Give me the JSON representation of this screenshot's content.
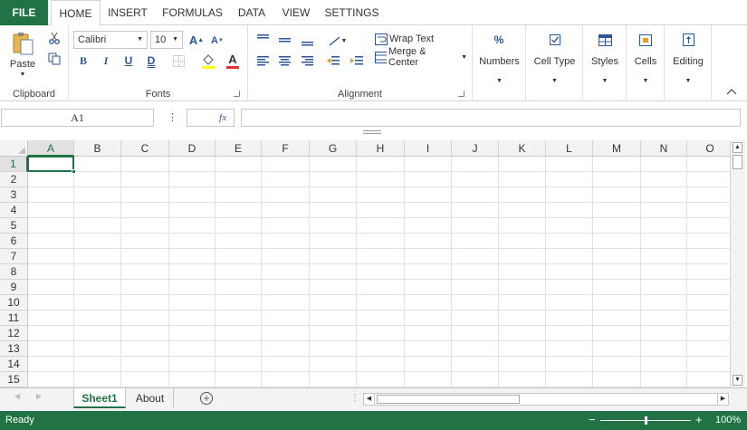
{
  "tabs": {
    "file": "FILE",
    "home": "HOME",
    "insert": "INSERT",
    "formulas": "FORMULAS",
    "data": "DATA",
    "view": "VIEW",
    "settings": "SETTINGS"
  },
  "clipboard": {
    "paste": "Paste",
    "label": "Clipboard"
  },
  "fonts": {
    "font_name": "Calibri",
    "font_size": "10",
    "label": "Fonts",
    "bold": "B",
    "italic": "I",
    "underline": "U",
    "double_underline": "D"
  },
  "alignment": {
    "wrap_text": "Wrap Text",
    "merge_center": "Merge & Center",
    "label": "Alignment"
  },
  "numbers": {
    "label": "Numbers"
  },
  "cell_type": {
    "label": "Cell Type"
  },
  "styles": {
    "label": "Styles"
  },
  "cells": {
    "label": "Cells"
  },
  "editing": {
    "label": "Editing"
  },
  "formula_bar": {
    "name_box": "A1",
    "fx": "fx",
    "more": "⋮",
    "formula": ""
  },
  "columns": [
    "A",
    "B",
    "C",
    "D",
    "E",
    "F",
    "G",
    "H",
    "I",
    "J",
    "K",
    "L",
    "M",
    "N",
    "O"
  ],
  "rows": [
    "1",
    "2",
    "3",
    "4",
    "5",
    "6",
    "7",
    "8",
    "9",
    "10",
    "11",
    "12",
    "13",
    "14",
    "15"
  ],
  "sheet_tabs": [
    "Sheet1",
    "About"
  ],
  "status": {
    "text": "Ready",
    "zoom": "100%",
    "zoom_level": 0.5
  },
  "colors": {
    "accent": "#217346",
    "fill_red": "#e03030",
    "selection": "#217346"
  }
}
